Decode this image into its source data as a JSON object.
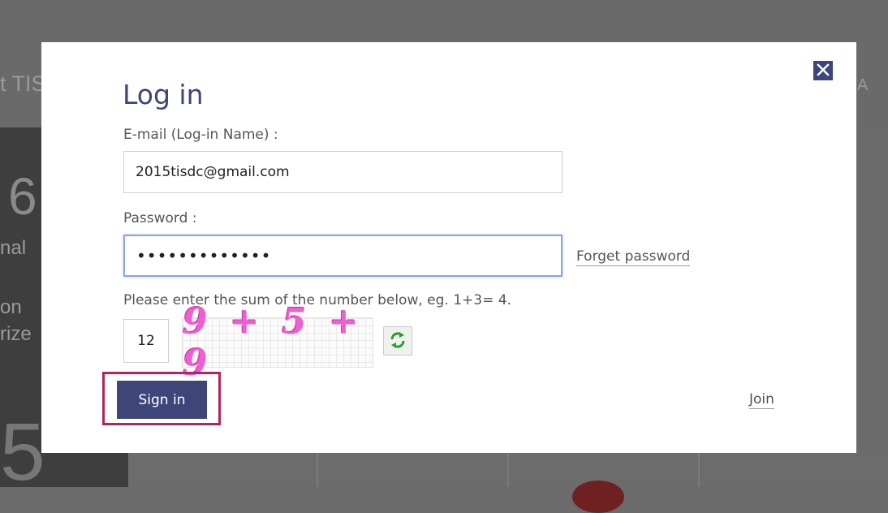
{
  "background": {
    "fragments": [
      "t TIS",
      "6",
      "nal",
      "on",
      "rize",
      "5",
      "A"
    ]
  },
  "modal": {
    "close_icon": "close-icon",
    "title": "Log in",
    "email": {
      "label": "E-mail (Log-in Name) :",
      "value": "2015tisdc@gmail.com"
    },
    "password": {
      "label": "Password :",
      "masked_value": "•••••••••••••"
    },
    "forget_password": "Forget password",
    "captcha": {
      "hint": "Please enter the sum of the number below, eg. 1+3= 4.",
      "answer": "12",
      "image_text": "9 + 5 + 9",
      "refresh_icon": "refresh-icon"
    },
    "sign_in": "Sign in",
    "join": "Join"
  },
  "colors": {
    "accent": "#3d4579",
    "highlight": "#b0255c",
    "captcha": "#ee5fd0"
  }
}
